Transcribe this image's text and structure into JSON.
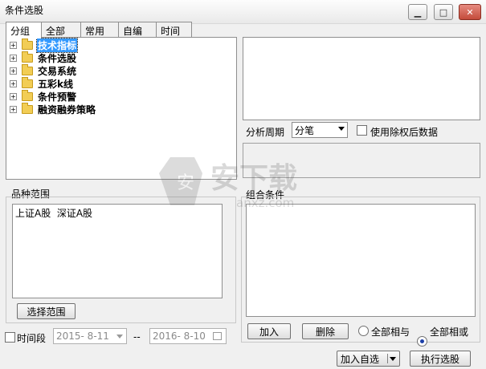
{
  "window": {
    "title": "条件选股",
    "min": "▭",
    "max": "▭",
    "close": "✕"
  },
  "tabs": [
    "分组",
    "全部",
    "常用",
    "自编",
    "时间"
  ],
  "tree": {
    "items": [
      "技术指标",
      "条件选股",
      "交易系统",
      "五彩k线",
      "条件预警",
      "融资融券策略"
    ]
  },
  "period": {
    "label": "分析周期",
    "value": "分笔"
  },
  "use_adjusted": {
    "label": "使用除权后数据"
  },
  "range": {
    "title": "品种范围",
    "items": "上证A股  深证A股",
    "button": "选择范围"
  },
  "combo_cond": {
    "title": "组合条件"
  },
  "actions": {
    "add": "加入",
    "delete": "删除",
    "and_label": "全部相与",
    "or_label": "全部相或",
    "add_fav": "加入自选",
    "run": "执行选股"
  },
  "timespan": {
    "label": "时间段",
    "start": "2015- 8-11",
    "sep": "--",
    "end": "2016- 8-10"
  },
  "watermark": {
    "text": "安下载",
    "sub": "anxz.com"
  }
}
